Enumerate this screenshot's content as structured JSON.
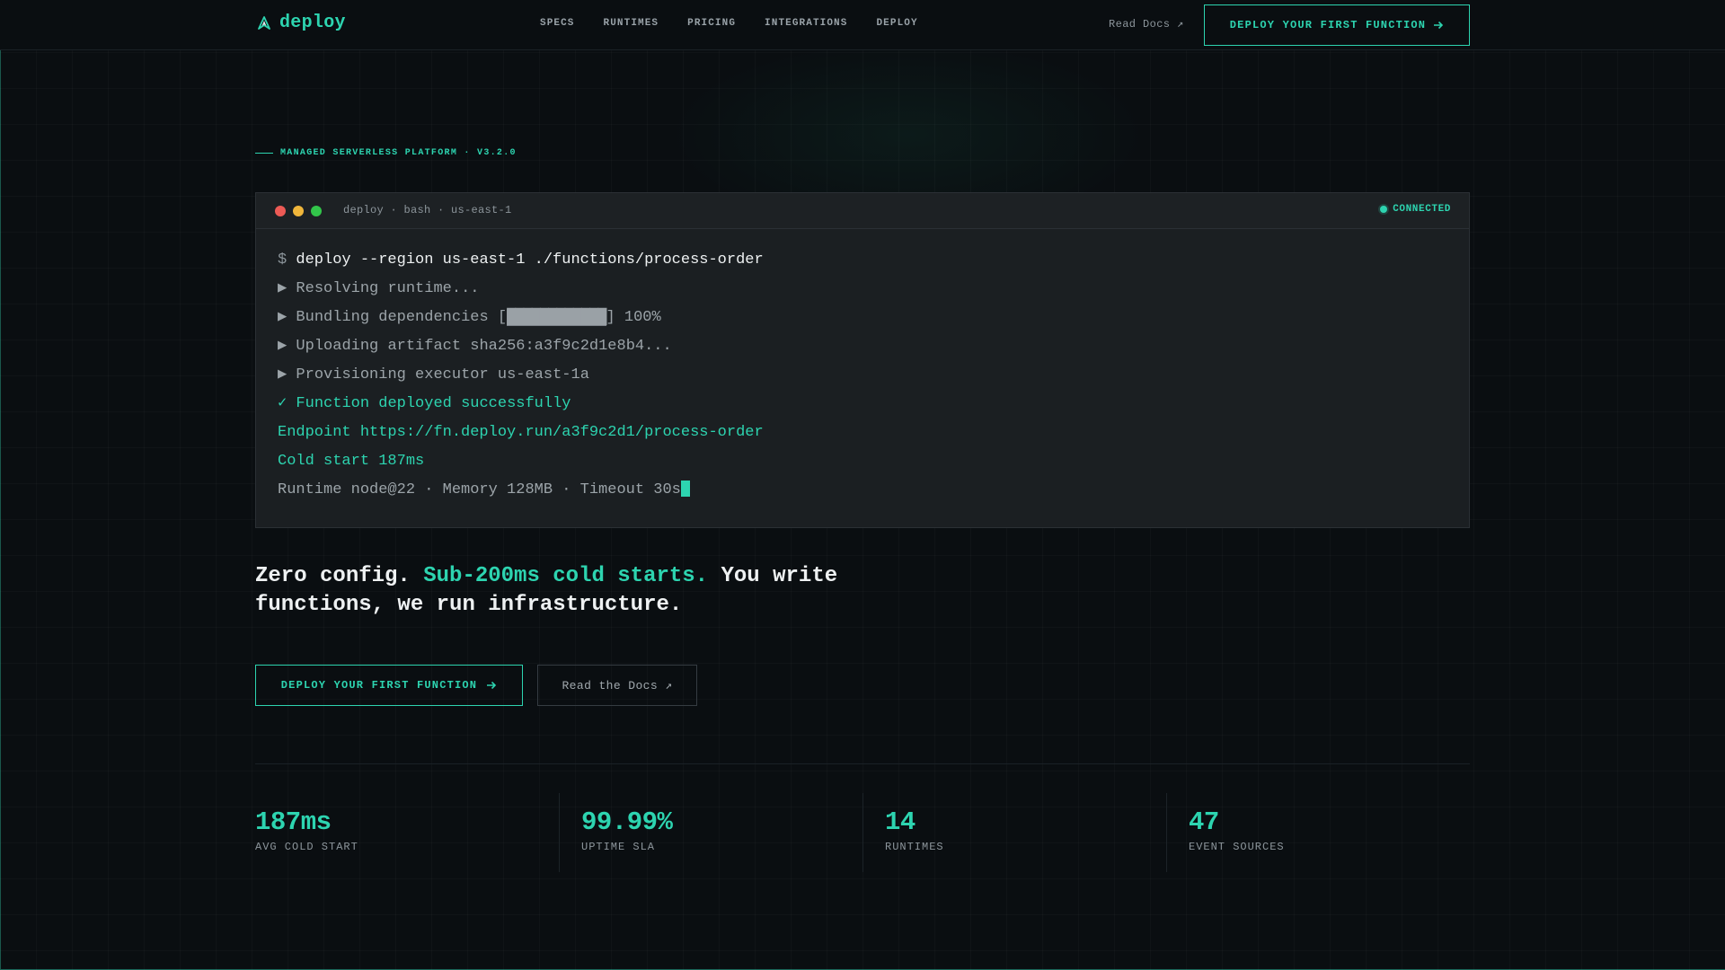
{
  "brand": {
    "name": "deploy",
    "accent": "#2dd4b0",
    "logo_icon": "rocket-chevron-icon"
  },
  "nav": {
    "links": [
      "SPECS",
      "RUNTIMES",
      "PRICING",
      "INTEGRATIONS",
      "DEPLOY"
    ],
    "docs_label": "Read Docs ↗",
    "cta_label": "DEPLOY YOUR FIRST FUNCTION"
  },
  "eyebrow": "MANAGED SERVERLESS PLATFORM · V3.2.0",
  "terminal": {
    "title": "deploy · bash · us-east-1",
    "status": "CONNECTED",
    "prompt": "$",
    "command": "deploy --region us-east-1 ./functions/process-order",
    "lines": [
      "▶ Resolving runtime...",
      "▶ Bundling dependencies [",
      "▶ Uploading artifact sha256:a3f9c2d1e8b4...",
      "▶ Provisioning executor us-east-1a"
    ],
    "progress_bar": "████████████",
    "progress_suffix": "] 100%",
    "progress_percent": 100,
    "success": "✓ Function deployed successfully",
    "endpoint": "Endpoint https://fn.deploy.run/a3f9c2d1/process-order",
    "cold_start": "Cold start 187ms",
    "runtime": "Runtime node@22 · Memory 128MB · Timeout 30s"
  },
  "headline": {
    "part1": "Zero config. ",
    "accent": "Sub-200ms cold starts.",
    "part2": " You write functions, we run infrastructure."
  },
  "buttons": {
    "primary": "DEPLOY YOUR FIRST FUNCTION",
    "secondary": "Read the Docs ↗"
  },
  "stats": [
    {
      "value": "187ms",
      "label": "AVG COLD START"
    },
    {
      "value": "99.99%",
      "label": "UPTIME SLA"
    },
    {
      "value": "14",
      "label": "RUNTIMES"
    },
    {
      "value": "47",
      "label": "EVENT SOURCES"
    }
  ]
}
